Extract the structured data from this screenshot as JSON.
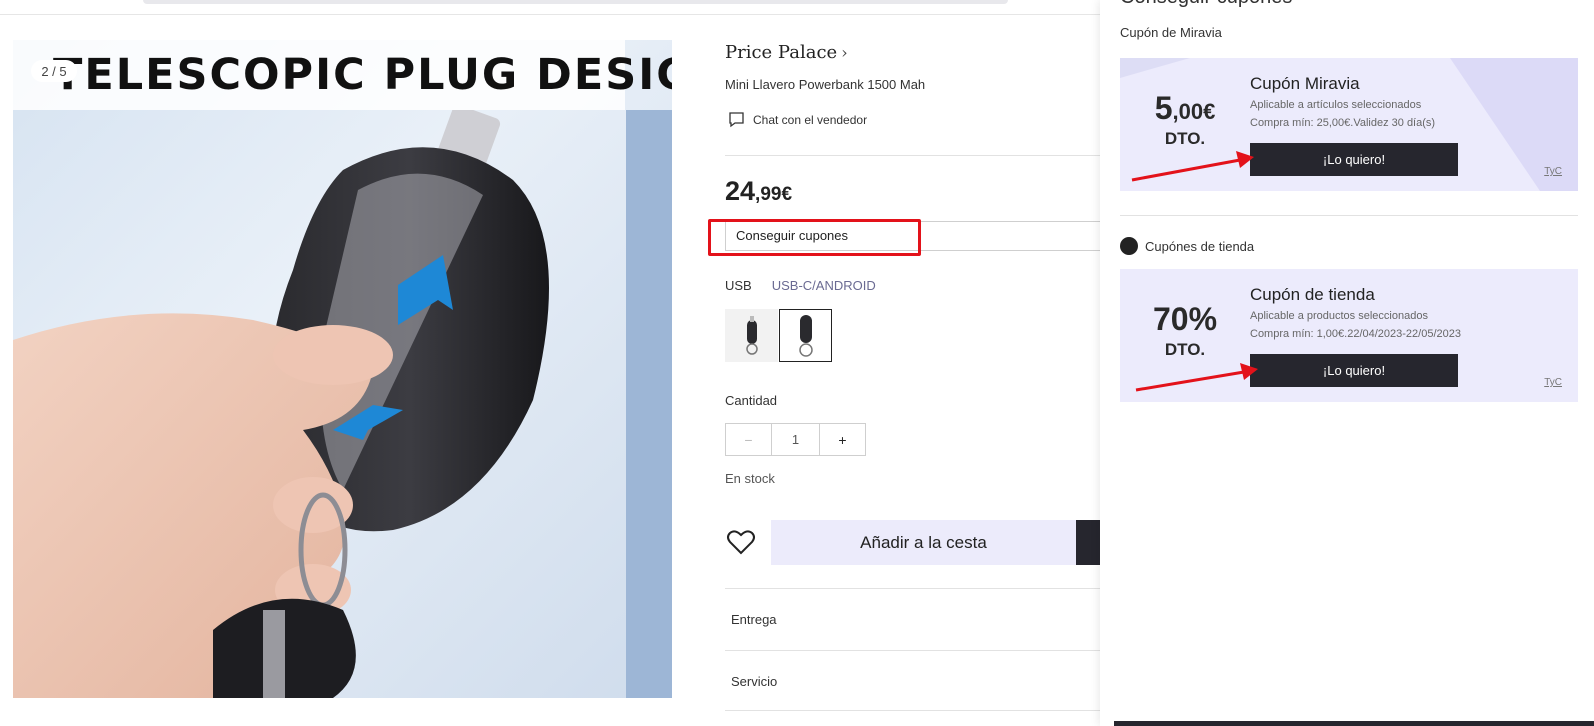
{
  "gallery": {
    "banner_text": "TELESCOPIC PLUG DESIGN",
    "counter": "2 / 5"
  },
  "product": {
    "store_name": "Price Palace",
    "title": "Mini Llavero Powerbank 1500 Mah",
    "chat_label": "Chat con el vendedor",
    "price_int": "24",
    "price_dec": ",99€",
    "coupon_row_label": "Conseguir cupones",
    "variant_label": "USB",
    "variant_selected": "USB-C/ANDROID",
    "quantity_label": "Cantidad",
    "quantity_value": "1",
    "stock_status": "En stock",
    "add_to_cart_label": "Añadir a la cesta",
    "accordion": [
      "Entrega",
      "Servicio"
    ]
  },
  "drawer": {
    "title": "Conseguir cupones",
    "section_miravia": "Cupón de Miravia",
    "section_store": "Cupónes de tienda",
    "coupons": [
      {
        "amount_big": "5",
        "amount_small": ",00€",
        "dto": "DTO.",
        "name": "Cupón Miravia",
        "desc1": "Aplicable a artículos seleccionados",
        "desc2": "Compra mín: 25,00€.Validez 30 día(s)",
        "button": "¡Lo quiero!",
        "tyc": "TyC"
      },
      {
        "amount_big": "70%",
        "amount_small": "",
        "dto": "DTO.",
        "name": "Cupón de tienda",
        "desc1": "Aplicable a productos seleccionados",
        "desc2": "Compra mín: 1,00€.22/04/2023-22/05/2023",
        "button": "¡Lo quiero!",
        "tyc": "TyC"
      }
    ]
  },
  "colors": {
    "accent_dark": "#26262e",
    "coupon_bg": "#ecebfc",
    "highlight_red": "#e3121a",
    "link_variant": "#6a6a92"
  }
}
